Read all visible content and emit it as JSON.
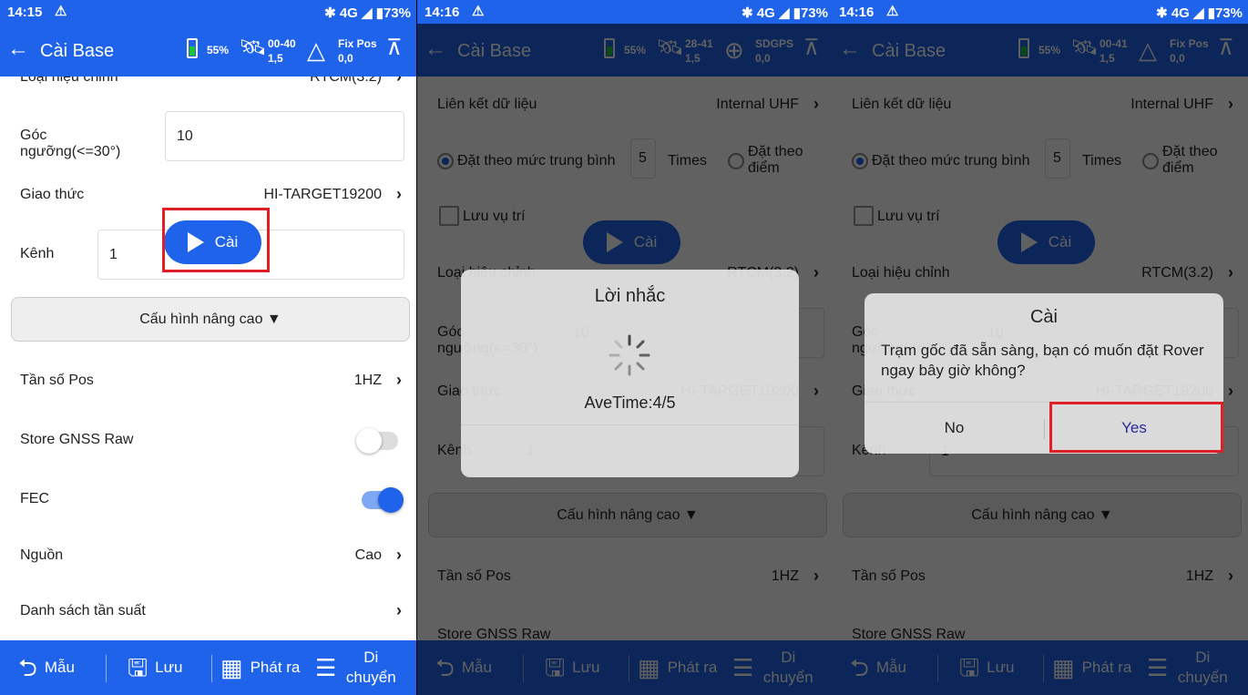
{
  "colors": {
    "primary": "#1f63ea",
    "highlight": "#e01e25"
  },
  "panels": [
    {
      "status": {
        "time": "14:15",
        "right": "✱ 4G ◢ ▮73%"
      },
      "appbar": {
        "title": "Cài Base",
        "battery": "55%",
        "sats": "00-40",
        "sats2": "1,5",
        "fix": "Fix Pos",
        "fix2": "0,0"
      },
      "rows": {
        "correction_label": "Loại hiệu chỉnh",
        "correction_value": "RTCM(3.2)",
        "angle_label": "Góc ngưỡng(<=30°)",
        "angle_value": "10",
        "protocol_label": "Giao thức",
        "protocol_value": "HI-TARGET19200",
        "channel_label": "Kênh",
        "channel_value": "1",
        "advanced": "Cấu hình nâng cao ▼",
        "pos_freq_label": "Tần số Pos",
        "pos_freq_value": "1HZ",
        "gnss_raw_label": "Store GNSS Raw",
        "gnss_raw_on": false,
        "fec_label": "FEC",
        "fec_on": true,
        "power_label": "Nguồn",
        "power_value": "Cao",
        "freq_list_label": "Danh sách tần suất"
      },
      "cai": "Cài"
    },
    {
      "status": {
        "time": "14:16",
        "right": "✱ 4G ◢ ▮73%"
      },
      "appbar": {
        "title": "Cài Base",
        "battery": "55%",
        "sats": "28-41",
        "sats2": "1,5",
        "fix": "SDGPS",
        "fix2": "0,0"
      },
      "rows": {
        "datalink_label": "Liên kết dữ liệu",
        "datalink_value": "Internal UHF",
        "avg_label": "Đặt theo mức trung bình",
        "avg_times": "5",
        "times_label": "Times",
        "point_label": "Đặt theo điểm",
        "save_pos_label": "Lưu vụ trí",
        "correction_label": "Loại hiệu chỉnh",
        "correction_value": "RTCM(3.2)",
        "angle_label": "Góc ngưỡng(<=30°)",
        "angle_value": "10",
        "protocol_label": "Giao thức",
        "protocol_value": "HI-TARGET19200",
        "channel_label": "Kênh",
        "channel_value": "1",
        "advanced": "Cấu hình nâng cao ▼",
        "pos_freq_label": "Tần số Pos",
        "pos_freq_value": "1HZ",
        "gnss_raw_label": "Store GNSS Raw"
      },
      "cai": "Cài",
      "dialog": {
        "title": "Lời nhắc",
        "message": "AveTime:4/5"
      }
    },
    {
      "status": {
        "time": "14:16",
        "right": "✱ 4G ◢ ▮73%"
      },
      "appbar": {
        "title": "Cài Base",
        "battery": "55%",
        "sats": "00-41",
        "sats2": "1,5",
        "fix": "Fix Pos",
        "fix2": "0,0"
      },
      "rows": {
        "datalink_label": "Liên kết dữ liệu",
        "datalink_value": "Internal UHF",
        "avg_label": "Đặt theo mức trung bình",
        "avg_times": "5",
        "times_label": "Times",
        "point_label": "Đặt theo điểm",
        "save_pos_label": "Lưu vụ trí",
        "correction_label": "Loại hiệu chỉnh",
        "correction_value": "RTCM(3.2)",
        "angle_label": "Góc ngưỡng(<=30°)",
        "angle_value": "10",
        "protocol_label": "Giao thức",
        "protocol_value": "HI-TARGET19200",
        "channel_label": "Kênh",
        "channel_value": "1",
        "advanced": "Cấu hình nâng cao ▼",
        "pos_freq_label": "Tần số Pos",
        "pos_freq_value": "1HZ",
        "gnss_raw_label": "Store GNSS Raw"
      },
      "cai": "Cài",
      "dialog": {
        "title": "Cài",
        "message": "Trạm gốc đã sẵn sàng, bạn có muốn đặt Rover ngay bây giờ không?",
        "no": "No",
        "yes": "Yes"
      }
    }
  ],
  "bottom": {
    "template": "Mẫu",
    "save": "Lưu",
    "broadcast": "Phát ra",
    "move": "Di chuyển"
  }
}
